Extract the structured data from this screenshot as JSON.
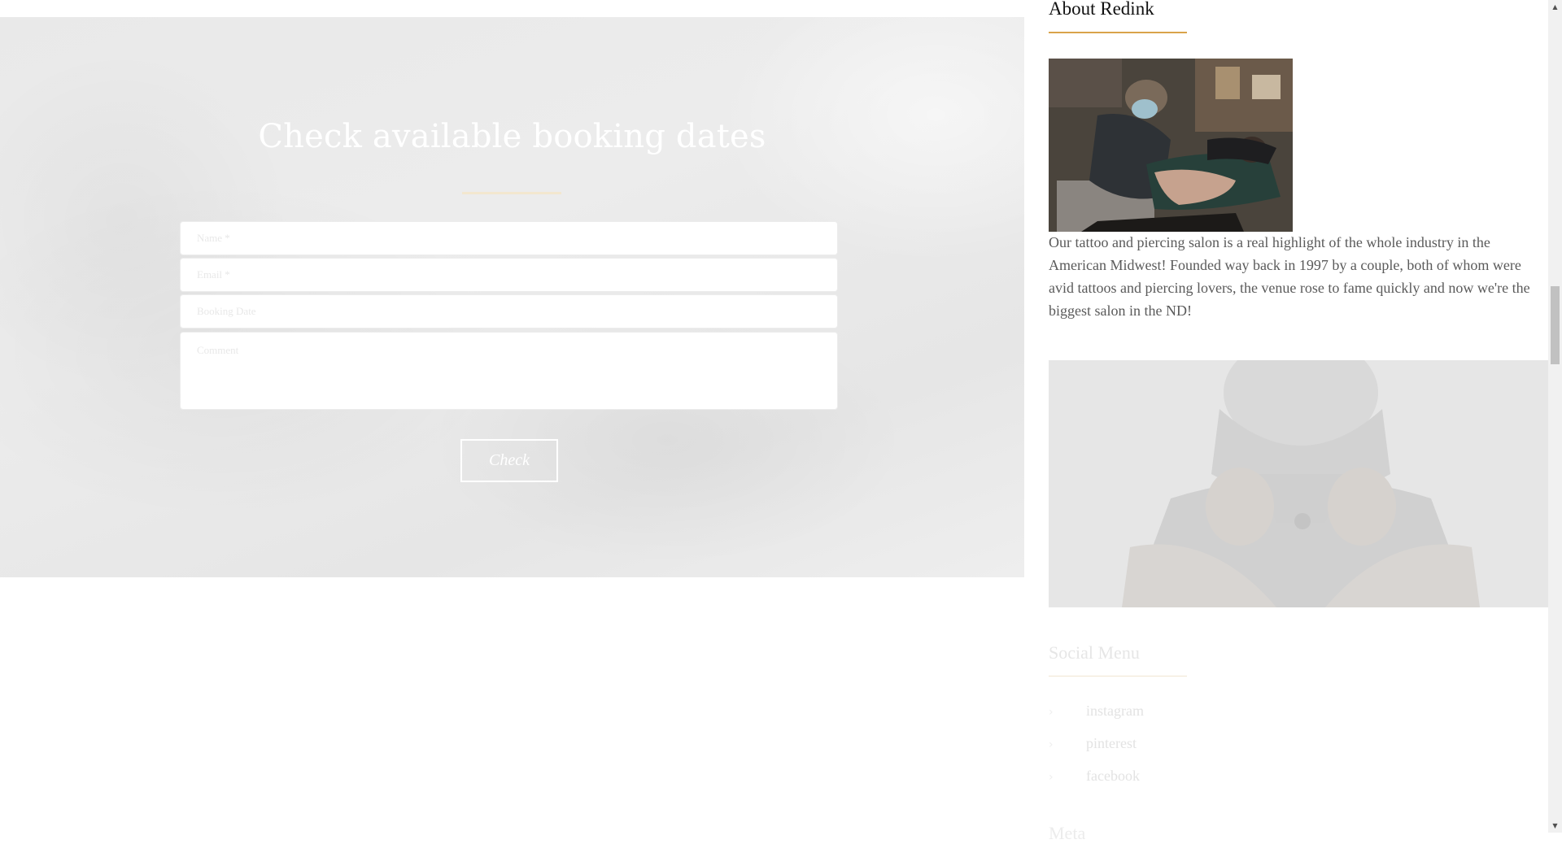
{
  "booking": {
    "title": "Check available booking dates",
    "name_placeholder": "Name *",
    "email_placeholder": "Email *",
    "date_placeholder": "Booking Date",
    "comment_placeholder": "Comment",
    "check_label": "Check"
  },
  "sidebar": {
    "about_title": "About Redink",
    "about_text": "Our tattoo and piercing salon is a real highlight of the whole industry in the American Midwest! Founded way back in 1997 by a couple, both of whom were avid tattoos and piercing lovers, the venue rose to fame quickly and now we're the biggest salon in the ND!",
    "social_title": "Social Menu",
    "social_items": [
      {
        "label": "instagram",
        "icon": "chevron-right-icon"
      },
      {
        "label": "pinterest",
        "icon": "chevron-right-icon"
      },
      {
        "label": "facebook",
        "icon": "chevron-right-icon"
      }
    ],
    "next_title_partial": "Meta"
  },
  "colors": {
    "accent_underline": "#d9a34a",
    "booking_underline": "#f3e7cf",
    "section_bg": "#ebebeb"
  }
}
